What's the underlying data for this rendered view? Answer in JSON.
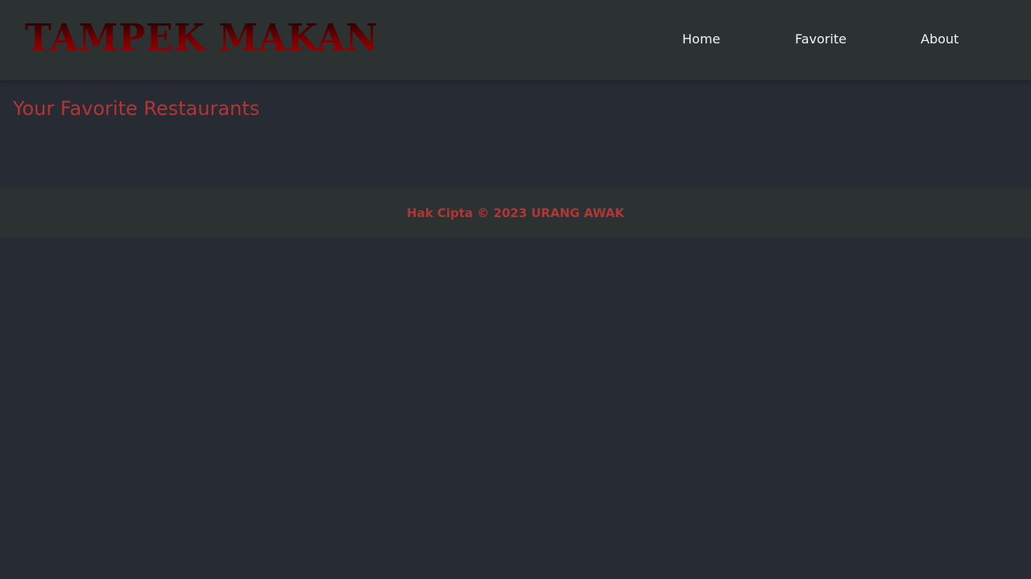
{
  "header": {
    "logo_text": "TAMPEK MAKAN",
    "nav": [
      {
        "label": "Home"
      },
      {
        "label": "Favorite"
      },
      {
        "label": "About"
      }
    ]
  },
  "main": {
    "title": "Your Favorite Restaurants",
    "restaurants": []
  },
  "footer": {
    "text": "Hak Cipta © 2023 URANG AWAK"
  },
  "colors": {
    "background": "#272b34",
    "bar_background": "#2c3232",
    "accent": "#b33535",
    "nav_text": "#f2f2f2",
    "logo_gradient": [
      "#1a0000",
      "#b30000"
    ]
  }
}
